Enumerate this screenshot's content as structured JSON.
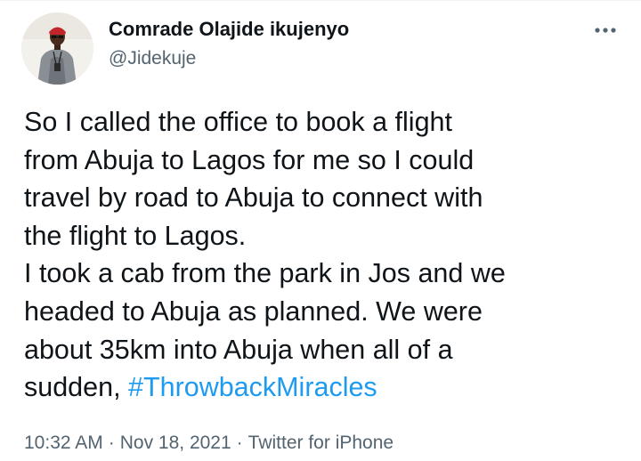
{
  "author": {
    "display_name": "Comrade Olajide ikujenyo",
    "handle": "@Jidekuje",
    "avatar_icon": "profile-photo"
  },
  "more_icon": "more-horizontal-icon",
  "tweet": {
    "lines": [
      "So I called the office to book a flight",
      "from Abuja to Lagos for me so I could",
      "travel by road to Abuja to connect with",
      "the flight to Lagos.",
      "I took a cab from the park in Jos and we",
      "headed to Abuja as planned. We were",
      "about 35km into Abuja when all of a"
    ],
    "last_line_text": "sudden, ",
    "hashtag": "#ThrowbackMiracles"
  },
  "meta": {
    "time": "10:32 AM",
    "separator": "·",
    "date": "Nov 18, 2021",
    "source": "Twitter for iPhone"
  },
  "colors": {
    "text": "#0f1419",
    "secondary": "#536471",
    "link": "#1d9bf0"
  }
}
